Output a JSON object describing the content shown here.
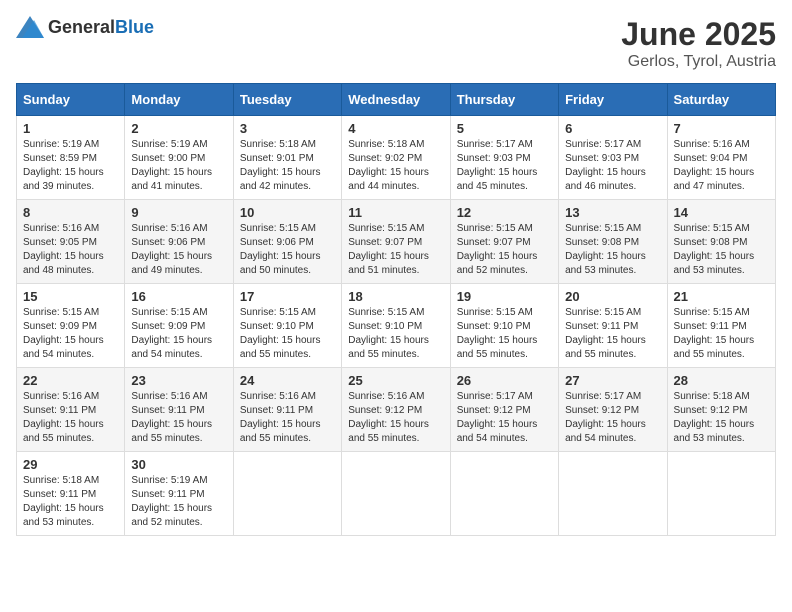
{
  "header": {
    "logo_general": "General",
    "logo_blue": "Blue",
    "month_title": "June 2025",
    "location": "Gerlos, Tyrol, Austria"
  },
  "weekdays": [
    "Sunday",
    "Monday",
    "Tuesday",
    "Wednesday",
    "Thursday",
    "Friday",
    "Saturday"
  ],
  "weeks": [
    [
      {
        "day": 1,
        "sunrise": "5:19 AM",
        "sunset": "8:59 PM",
        "daylight": "15 hours and 39 minutes."
      },
      {
        "day": 2,
        "sunrise": "5:19 AM",
        "sunset": "9:00 PM",
        "daylight": "15 hours and 41 minutes."
      },
      {
        "day": 3,
        "sunrise": "5:18 AM",
        "sunset": "9:01 PM",
        "daylight": "15 hours and 42 minutes."
      },
      {
        "day": 4,
        "sunrise": "5:18 AM",
        "sunset": "9:02 PM",
        "daylight": "15 hours and 44 minutes."
      },
      {
        "day": 5,
        "sunrise": "5:17 AM",
        "sunset": "9:03 PM",
        "daylight": "15 hours and 45 minutes."
      },
      {
        "day": 6,
        "sunrise": "5:17 AM",
        "sunset": "9:03 PM",
        "daylight": "15 hours and 46 minutes."
      },
      {
        "day": 7,
        "sunrise": "5:16 AM",
        "sunset": "9:04 PM",
        "daylight": "15 hours and 47 minutes."
      }
    ],
    [
      {
        "day": 8,
        "sunrise": "5:16 AM",
        "sunset": "9:05 PM",
        "daylight": "15 hours and 48 minutes."
      },
      {
        "day": 9,
        "sunrise": "5:16 AM",
        "sunset": "9:06 PM",
        "daylight": "15 hours and 49 minutes."
      },
      {
        "day": 10,
        "sunrise": "5:15 AM",
        "sunset": "9:06 PM",
        "daylight": "15 hours and 50 minutes."
      },
      {
        "day": 11,
        "sunrise": "5:15 AM",
        "sunset": "9:07 PM",
        "daylight": "15 hours and 51 minutes."
      },
      {
        "day": 12,
        "sunrise": "5:15 AM",
        "sunset": "9:07 PM",
        "daylight": "15 hours and 52 minutes."
      },
      {
        "day": 13,
        "sunrise": "5:15 AM",
        "sunset": "9:08 PM",
        "daylight": "15 hours and 53 minutes."
      },
      {
        "day": 14,
        "sunrise": "5:15 AM",
        "sunset": "9:08 PM",
        "daylight": "15 hours and 53 minutes."
      }
    ],
    [
      {
        "day": 15,
        "sunrise": "5:15 AM",
        "sunset": "9:09 PM",
        "daylight": "15 hours and 54 minutes."
      },
      {
        "day": 16,
        "sunrise": "5:15 AM",
        "sunset": "9:09 PM",
        "daylight": "15 hours and 54 minutes."
      },
      {
        "day": 17,
        "sunrise": "5:15 AM",
        "sunset": "9:10 PM",
        "daylight": "15 hours and 55 minutes."
      },
      {
        "day": 18,
        "sunrise": "5:15 AM",
        "sunset": "9:10 PM",
        "daylight": "15 hours and 55 minutes."
      },
      {
        "day": 19,
        "sunrise": "5:15 AM",
        "sunset": "9:10 PM",
        "daylight": "15 hours and 55 minutes."
      },
      {
        "day": 20,
        "sunrise": "5:15 AM",
        "sunset": "9:11 PM",
        "daylight": "15 hours and 55 minutes."
      },
      {
        "day": 21,
        "sunrise": "5:15 AM",
        "sunset": "9:11 PM",
        "daylight": "15 hours and 55 minutes."
      }
    ],
    [
      {
        "day": 22,
        "sunrise": "5:16 AM",
        "sunset": "9:11 PM",
        "daylight": "15 hours and 55 minutes."
      },
      {
        "day": 23,
        "sunrise": "5:16 AM",
        "sunset": "9:11 PM",
        "daylight": "15 hours and 55 minutes."
      },
      {
        "day": 24,
        "sunrise": "5:16 AM",
        "sunset": "9:11 PM",
        "daylight": "15 hours and 55 minutes."
      },
      {
        "day": 25,
        "sunrise": "5:16 AM",
        "sunset": "9:12 PM",
        "daylight": "15 hours and 55 minutes."
      },
      {
        "day": 26,
        "sunrise": "5:17 AM",
        "sunset": "9:12 PM",
        "daylight": "15 hours and 54 minutes."
      },
      {
        "day": 27,
        "sunrise": "5:17 AM",
        "sunset": "9:12 PM",
        "daylight": "15 hours and 54 minutes."
      },
      {
        "day": 28,
        "sunrise": "5:18 AM",
        "sunset": "9:12 PM",
        "daylight": "15 hours and 53 minutes."
      }
    ],
    [
      {
        "day": 29,
        "sunrise": "5:18 AM",
        "sunset": "9:11 PM",
        "daylight": "15 hours and 53 minutes."
      },
      {
        "day": 30,
        "sunrise": "5:19 AM",
        "sunset": "9:11 PM",
        "daylight": "15 hours and 52 minutes."
      },
      null,
      null,
      null,
      null,
      null
    ]
  ]
}
